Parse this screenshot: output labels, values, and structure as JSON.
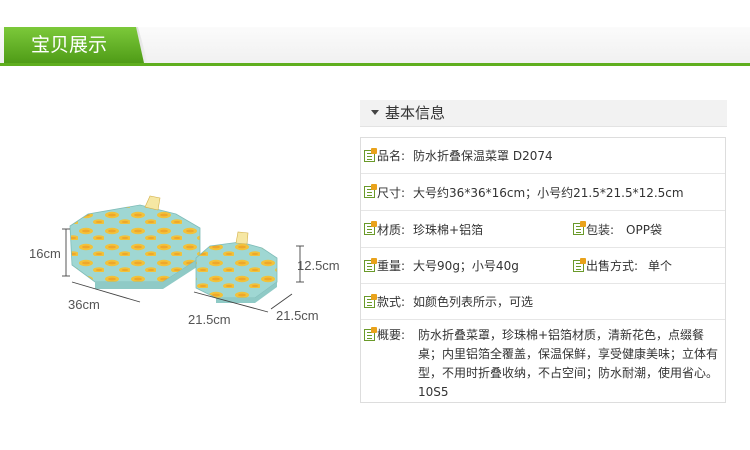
{
  "header": {
    "tab_label": "宝贝展示"
  },
  "illustration": {
    "large_height": "16cm",
    "large_length": "36cm",
    "small_height": "12.5cm",
    "small_width": "21.5cm",
    "small_length": "21.5cm",
    "colors": {
      "teal": "#9fd7d3",
      "leaf": "#f2c23a",
      "leaf_dot": "#e98c1c"
    }
  },
  "info": {
    "title": "基本信息",
    "rows": [
      {
        "label": "品名:",
        "value": "防水折叠保温菜罩 D2074"
      },
      {
        "label": "尺寸:",
        "value": "大号约36*36*16cm；小号约21.5*21.5*12.5cm"
      },
      {
        "label": "材质:",
        "value": "珍珠棉+铝箔",
        "label2": "包装:",
        "value2": "OPP袋"
      },
      {
        "label": "重量:",
        "value": "大号90g；小号40g",
        "label2": "出售方式:",
        "value2": "单个"
      },
      {
        "label": "款式:",
        "value": "如颜色列表所示，可选"
      },
      {
        "label": "概要:",
        "value": "防水折叠菜罩，珍珠棉+铝箔材质，清新花色，点缀餐桌；内里铝箔全覆盖，保温保鲜，享受健康美味；立体有型，不用时折叠收纳，不占空间；防水耐潮，使用省心。10S5"
      }
    ]
  },
  "accent_color": "#5fae1e"
}
